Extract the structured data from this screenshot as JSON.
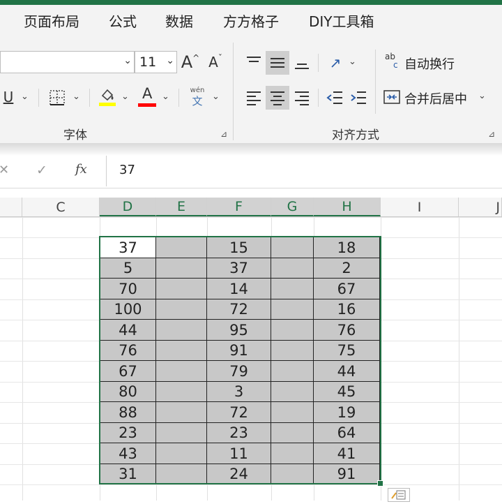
{
  "ribbon": {
    "tabs": [
      "页面布局",
      "公式",
      "数据",
      "方方格子",
      "DIY工具箱"
    ],
    "font": {
      "name": "",
      "size": "11",
      "group_label": "字体",
      "grow_label": "A",
      "shrink_label": "A",
      "underline_label": "U",
      "font_color_label": "A",
      "phonetic_top": "wén",
      "phonetic_bottom": "文",
      "highlight_color": "#ffff00",
      "font_color": "#ff0000"
    },
    "alignment": {
      "group_label": "对齐方式",
      "wrap_text_label": "自动换行",
      "merge_center_label": "合并后居中",
      "wrap_icon_top": "ab",
      "wrap_icon_bottom": "c"
    }
  },
  "formula_bar": {
    "cancel_glyph": "✕",
    "enter_glyph": "✓",
    "fx_label": "fx",
    "value": "37"
  },
  "sheet": {
    "columns": [
      "C",
      "D",
      "E",
      "F",
      "G",
      "H",
      "I",
      "J"
    ],
    "selected_columns": [
      "D",
      "E",
      "F",
      "G",
      "H"
    ],
    "accent_color": "#217346",
    "cell_fill": "#c8c8c8",
    "col_d": [
      "37",
      "5",
      "70",
      "100",
      "44",
      "76",
      "67",
      "80",
      "88",
      "23",
      "43",
      "31"
    ],
    "col_f": [
      "15",
      "37",
      "14",
      "72",
      "95",
      "91",
      "79",
      "3",
      "72",
      "23",
      "11",
      "24"
    ],
    "col_h": [
      "18",
      "2",
      "67",
      "16",
      "76",
      "75",
      "44",
      "45",
      "19",
      "64",
      "41",
      "91"
    ]
  }
}
